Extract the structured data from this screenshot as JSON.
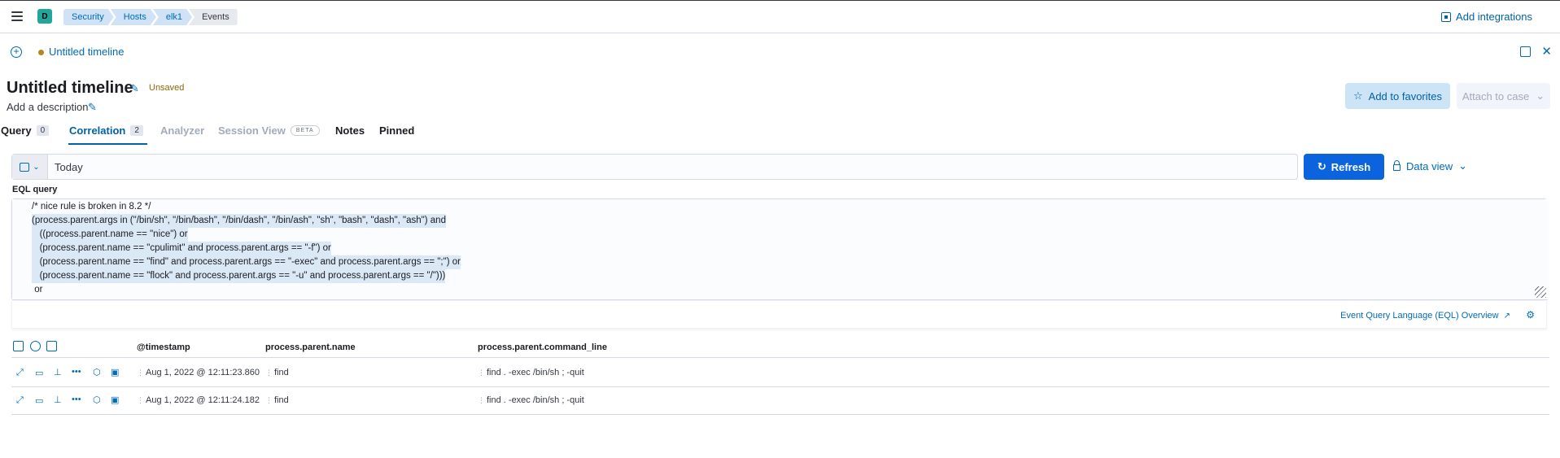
{
  "header": {
    "space_initial": "D",
    "breadcrumbs": [
      "Security",
      "Hosts",
      "elk1",
      "Events"
    ],
    "add_integrations": "Add integrations"
  },
  "timeline_bar": {
    "name": "Untitled timeline"
  },
  "timeline": {
    "title": "Untitled timeline",
    "status": "Unsaved",
    "description_placeholder": "Add a description",
    "add_to_favorites": "Add to favorites",
    "attach_to_case": "Attach to case"
  },
  "tabs": [
    {
      "label": "Query",
      "count": "0"
    },
    {
      "label": "Correlation",
      "count": "2"
    },
    {
      "label": "Analyzer"
    },
    {
      "label": "Session View",
      "badge": "BETA"
    },
    {
      "label": "Notes"
    },
    {
      "label": "Pinned"
    }
  ],
  "query_bar": {
    "date_range": "Today",
    "refresh": "Refresh",
    "data_view": "Data view"
  },
  "eql": {
    "label": "EQL query",
    "lines": [
      "/* nice rule is broken in 8.2 */",
      "(process.parent.args in (\"/bin/sh\", \"/bin/bash\", \"/bin/dash\", \"/bin/ash\", \"sh\", \"bash\", \"dash\", \"ash\") and",
      "   ((process.parent.name == \"nice\") or",
      "   (process.parent.name == \"cpulimit\" and process.parent.args == \"-f\") or",
      "   (process.parent.name == \"find\" and process.parent.args == \"-exec\" and process.parent.args == \";\") or",
      "   (process.parent.name == \"flock\" and process.parent.args == \"-u\" and process.parent.args == \"/\")))",
      " or"
    ],
    "docs_link": "Event Query Language (EQL) Overview"
  },
  "grid": {
    "columns": [
      "@timestamp",
      "process.parent.name",
      "process.parent.command_line"
    ],
    "rows": [
      {
        "timestamp": "Aug 1, 2022 @ 12:11:23.860",
        "parent_name": "find",
        "command_line": "find . -exec /bin/sh ; -quit"
      },
      {
        "timestamp": "Aug 1, 2022 @ 12:11:24.182",
        "parent_name": "find",
        "command_line": "find . -exec /bin/sh ; -quit"
      }
    ]
  },
  "colors": {
    "accent": "#0061a6",
    "primary_button": "#0b64dd",
    "space_avatar": "#20a69a",
    "unsaved": "#8a6a0a"
  }
}
